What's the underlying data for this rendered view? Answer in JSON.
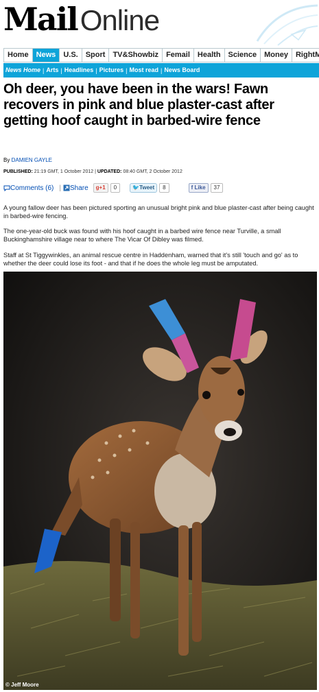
{
  "masthead": {
    "logo_mail": "Mail",
    "logo_online": "Online"
  },
  "nav": {
    "items": [
      {
        "label": "Home",
        "active": false
      },
      {
        "label": "News",
        "active": true
      },
      {
        "label": "U.S.",
        "active": false
      },
      {
        "label": "Sport",
        "active": false
      },
      {
        "label": "TV&Showbiz",
        "active": false
      },
      {
        "label": "Femail",
        "active": false
      },
      {
        "label": "Health",
        "active": false
      },
      {
        "label": "Science",
        "active": false
      },
      {
        "label": "Money",
        "active": false
      },
      {
        "label": "RightMin",
        "active": false
      }
    ]
  },
  "subnav": {
    "items": [
      {
        "label": "News Home",
        "current": true
      },
      {
        "label": "Arts",
        "current": false
      },
      {
        "label": "Headlines",
        "current": false
      },
      {
        "label": "Pictures",
        "current": false
      },
      {
        "label": "Most read",
        "current": false
      },
      {
        "label": "News Board",
        "current": false
      }
    ]
  },
  "article": {
    "headline": "Oh deer, you have been in the wars! Fawn recovers in pink and blue plaster-cast after getting hoof caught in barbed-wire fence",
    "byline_prefix": "By",
    "author": "DAMIEN GAYLE",
    "published_label": "PUBLISHED:",
    "published": "21:19 GMT, 1 October 2012",
    "updated_label": "UPDATED:",
    "updated": "08:40 GMT, 2 October 2012",
    "paragraphs": [
      "A young fallow deer has been pictured sporting an unusual bright pink and blue plaster-cast after being caught in barbed-wire fencing.",
      "The one-year-old buck was found with his hoof caught in a barbed wire fence near Turville, a small Buckinghamshire village near to where The Vicar Of Dibley was filmed.",
      "Staff at St Tiggywinkles, an animal rescue centre in Haddenham, warned that it's still 'touch and go' as to whether the deer could lose its foot - and that if he does the whole leg must be amputated."
    ],
    "photo_credit": "© Jeff Moore"
  },
  "share": {
    "comments_label": "Comments (6)",
    "share_label": "Share",
    "gplus_label": "+1",
    "gplus_count": "0",
    "tweet_label": "Tweet",
    "tweet_count": "8",
    "like_label": "Like",
    "like_count": "37"
  },
  "colors": {
    "accent": "#0ea4d9",
    "link": "#004db3"
  }
}
